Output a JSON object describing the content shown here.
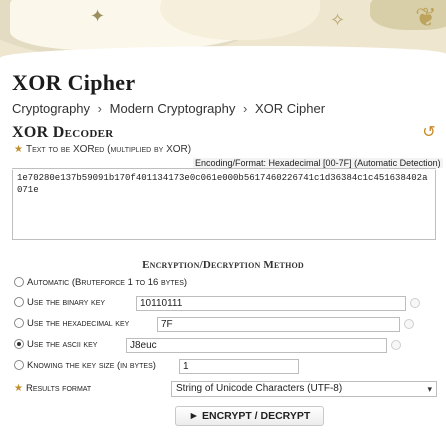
{
  "header": {
    "title": "XOR Cipher",
    "breadcrumb": [
      "Cryptography",
      "Modern Cryptography",
      "XOR Cipher"
    ],
    "breadcrumb_sep": "›"
  },
  "decoder": {
    "title": "XOR Decoder",
    "field_label": "Text to be XORed (multiplied by XOR)",
    "encoding_label": "Encoding/Format: Hexadecimal [00-7F] (Automatic Detection)",
    "text_value": "1e70280e137b59091b170f401134173e0c061e000b5617460226741c1d36384c1c451638402a071e"
  },
  "method": {
    "title": "Encryption/Decryption Method",
    "options": [
      {
        "label": "Automatic (Bruteforce 1 to 16 bytes)",
        "checked": false
      },
      {
        "label": "Use the binary key",
        "value": "10110111",
        "checked": false
      },
      {
        "label": "Use the hexadecimal key",
        "value": "7F",
        "checked": false
      },
      {
        "label": "Use the ascii key",
        "value": "J8euc",
        "checked": true
      },
      {
        "label": "Knowing the key size (in bytes)",
        "value": "1",
        "checked": false
      }
    ],
    "results_label": "Results format",
    "results_value": "String of Unicode Characters (UTF-8)",
    "button": "► ENCRYPT / DECRYPT"
  },
  "icons": {
    "refresh": "refresh-icon",
    "star": "star-icon",
    "chevron": "chevron-down-icon"
  },
  "colors": {
    "accent": "#c0902a",
    "banner": "#efe6cf"
  }
}
